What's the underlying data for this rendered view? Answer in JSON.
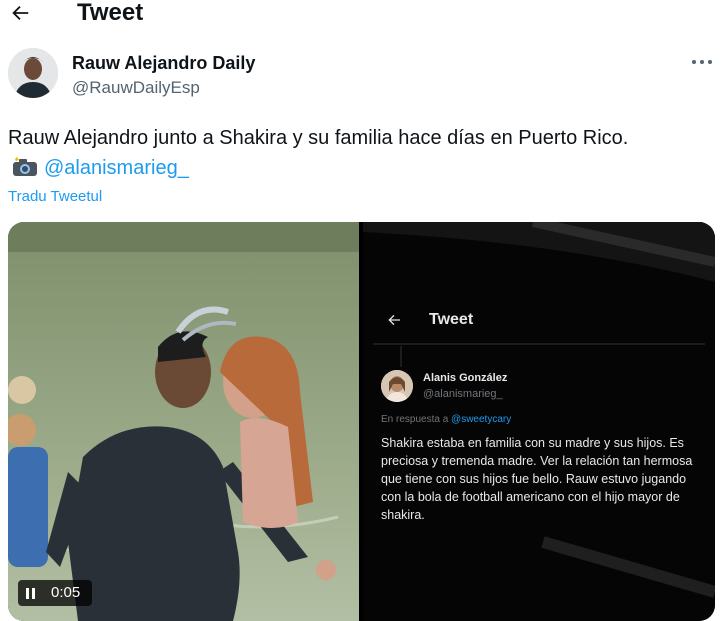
{
  "header": {
    "title": "Tweet"
  },
  "author": {
    "name": "Rauw Alejandro Daily",
    "handle": "@RauwDailyEsp"
  },
  "tweet": {
    "text": "Rauw Alejandro junto a Shakira y su familia hace días en Puerto Rico.",
    "mention": "@alanismarieg_",
    "translate_label": "Tradu Tweetul"
  },
  "video": {
    "time": "0:05"
  },
  "embedded_screenshot": {
    "header_title": "Tweet",
    "author_name": "Alanis González",
    "author_handle": "@alanismarieg_",
    "reply_prefix": "En respuesta a",
    "reply_to": "@sweetycary",
    "text": "Shakira estaba en familia con su madre y sus hijos. Es preciosa y tremenda madre. Ver la relación tan hermosa que tiene con sus hijos fue bello. Rauw estuvo jugando con la bola de football americano con el hijo mayor de shakira."
  },
  "colors": {
    "accent": "#1d9bf0",
    "text": "#0f1419",
    "secondary": "#536471"
  },
  "icons": [
    "back-arrow-icon",
    "more-icon",
    "camera-icon",
    "pause-icon"
  ]
}
